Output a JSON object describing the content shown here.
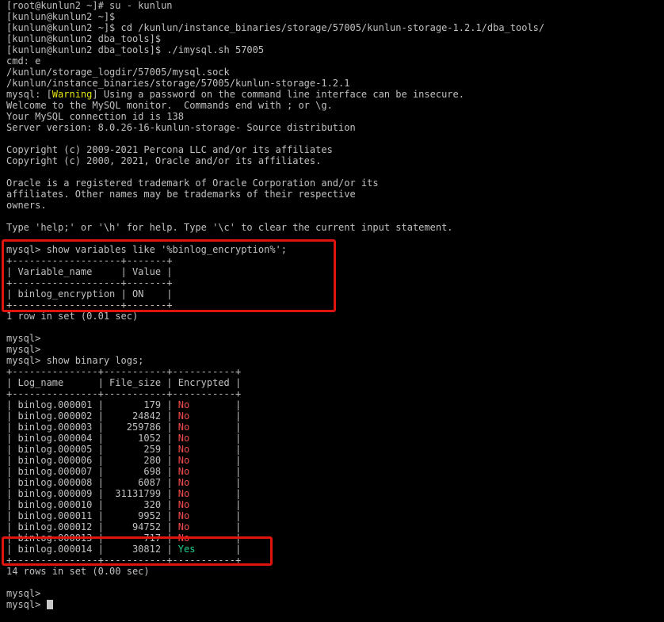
{
  "terminal": {
    "lines": [
      "[root@kunlun2 ~]# su - kunlun",
      "[kunlun@kunlun2 ~]$",
      "[kunlun@kunlun2 ~]$ cd /kunlun/instance_binaries/storage/57005/kunlun-storage-1.2.1/dba_tools/",
      "[kunlun@kunlun2 dba_tools]$",
      "[kunlun@kunlun2 dba_tools]$ ./imysql.sh 57005",
      "cmd: e",
      "/kunlun/storage_logdir/57005/mysql.sock",
      "/kunlun/instance_binaries/storage/57005/kunlun-storage-1.2.1"
    ],
    "warning_line": {
      "prefix": "mysql: [",
      "tag": "Warning",
      "suffix": "] Using a password on the command line interface can be insecure."
    },
    "lines_2": [
      "Welcome to the MySQL monitor.  Commands end with ; or \\g.",
      "Your MySQL connection id is 138",
      "Server version: 8.0.26-16-kunlun-storage- Source distribution",
      "",
      "Copyright (c) 2009-2021 Percona LLC and/or its affiliates",
      "Copyright (c) 2000, 2021, Oracle and/or its affiliates.",
      "",
      "Oracle is a registered trademark of Oracle Corporation and/or its",
      "affiliates. Other names may be trademarks of their respective",
      "owners.",
      "",
      "Type 'help;' or '\\h' for help. Type '\\c' to clear the current input statement.",
      "",
      "mysql> show variables like '%binlog_encryption%';",
      "+-------------------+-------+",
      "| Variable_name     | Value |",
      "+-------------------+-------+",
      "| binlog_encryption | ON    |",
      "+-------------------+-------+",
      "1 row in set (0.01 sec)",
      "",
      "mysql>",
      "mysql>",
      "mysql> show binary logs;",
      "+---------------+-----------+-----------+",
      "| Log_name      | File_size | Encrypted |",
      "+---------------+-----------+-----------+"
    ],
    "binlog_rows": [
      {
        "name": "binlog.000001",
        "size": "179",
        "encrypted": "No"
      },
      {
        "name": "binlog.000002",
        "size": "24842",
        "encrypted": "No"
      },
      {
        "name": "binlog.000003",
        "size": "259786",
        "encrypted": "No"
      },
      {
        "name": "binlog.000004",
        "size": "1052",
        "encrypted": "No"
      },
      {
        "name": "binlog.000005",
        "size": "259",
        "encrypted": "No"
      },
      {
        "name": "binlog.000006",
        "size": "280",
        "encrypted": "No"
      },
      {
        "name": "binlog.000007",
        "size": "698",
        "encrypted": "No"
      },
      {
        "name": "binlog.000008",
        "size": "6087",
        "encrypted": "No"
      },
      {
        "name": "binlog.000009",
        "size": "31131799",
        "encrypted": "No"
      },
      {
        "name": "binlog.000010",
        "size": "320",
        "encrypted": "No"
      },
      {
        "name": "binlog.000011",
        "size": "9952",
        "encrypted": "No"
      },
      {
        "name": "binlog.000012",
        "size": "94752",
        "encrypted": "No"
      },
      {
        "name": "binlog.000013",
        "size": "717",
        "encrypted": "No"
      },
      {
        "name": "binlog.000014",
        "size": "30812",
        "encrypted": "Yes"
      }
    ],
    "lines_3": [
      "+---------------+-----------+-----------+",
      "14 rows in set (0.00 sec)",
      "",
      "mysql>",
      "mysql> "
    ]
  },
  "colors": {
    "background": "#000000",
    "text": "#c0c0c0",
    "warning": "#e5e510",
    "no": "#f24c4c",
    "yes": "#23d18b",
    "highlight_box": "#e0140e"
  }
}
